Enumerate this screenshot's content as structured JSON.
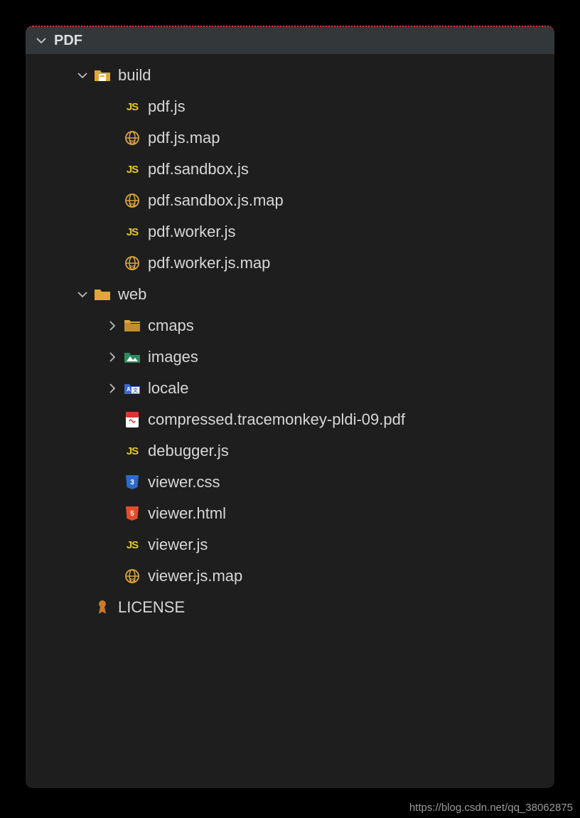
{
  "header": {
    "title": "PDF"
  },
  "tree": {
    "build": {
      "label": "build",
      "files": [
        {
          "name": "pdf.js",
          "icon": "js"
        },
        {
          "name": "pdf.js.map",
          "icon": "map"
        },
        {
          "name": "pdf.sandbox.js",
          "icon": "js"
        },
        {
          "name": "pdf.sandbox.js.map",
          "icon": "map"
        },
        {
          "name": "pdf.worker.js",
          "icon": "js"
        },
        {
          "name": "pdf.worker.js.map",
          "icon": "map"
        }
      ]
    },
    "web": {
      "label": "web",
      "folders": [
        {
          "name": "cmaps",
          "icon": "folder"
        },
        {
          "name": "images",
          "icon": "folder-img"
        },
        {
          "name": "locale",
          "icon": "folder-loc"
        }
      ],
      "files": [
        {
          "name": "compressed.tracemonkey-pldi-09.pdf",
          "icon": "pdf"
        },
        {
          "name": "debugger.js",
          "icon": "js"
        },
        {
          "name": "viewer.css",
          "icon": "css"
        },
        {
          "name": "viewer.html",
          "icon": "html"
        },
        {
          "name": "viewer.js",
          "icon": "js"
        },
        {
          "name": "viewer.js.map",
          "icon": "map"
        }
      ]
    },
    "rootFiles": [
      {
        "name": "LICENSE",
        "icon": "license"
      }
    ]
  },
  "watermark": "https://blog.csdn.net/qq_38062875"
}
